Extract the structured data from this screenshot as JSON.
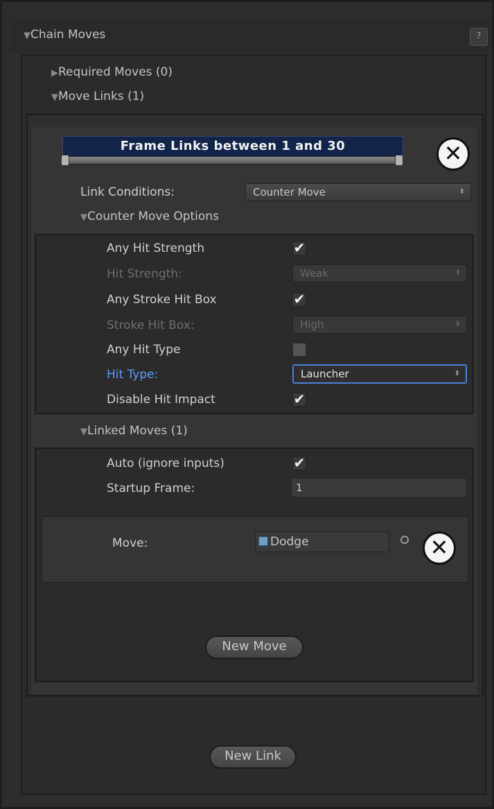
{
  "panel": {
    "title": "Chain Moves",
    "help_label": "?"
  },
  "sections": {
    "required_moves": "Required Moves (0)",
    "move_links": "Move Links (1)"
  },
  "link": {
    "frame_bar_label": "Frame Links between 1 and 30",
    "link_conditions_label": "Link Conditions:",
    "link_conditions_value": "Counter Move",
    "counter_move_options_label": "Counter Move Options",
    "options": {
      "any_hit_strength_label": "Any Hit Strength",
      "any_hit_strength_checked": true,
      "hit_strength_label": "Hit Strength:",
      "hit_strength_value": "Weak",
      "any_stroke_hit_box_label": "Any Stroke Hit Box",
      "any_stroke_hit_box_checked": true,
      "stroke_hit_box_label": "Stroke Hit Box:",
      "stroke_hit_box_value": "High",
      "any_hit_type_label": "Any Hit Type",
      "any_hit_type_checked": false,
      "hit_type_label": "Hit Type:",
      "hit_type_value": "Launcher",
      "disable_hit_impact_label": "Disable Hit Impact",
      "disable_hit_impact_checked": true
    },
    "linked_moves_label": "Linked Moves (1)",
    "auto_label": "Auto (ignore inputs)",
    "auto_checked": true,
    "startup_frame_label": "Startup Frame:",
    "startup_frame_value": "1",
    "move_label": "Move:",
    "move_value": "Dodge",
    "new_move_label": "New Move"
  },
  "new_link_label": "New Link",
  "glyphs": {
    "check": "✔",
    "close": "✕",
    "down_triangle": "▼",
    "right_triangle": "▶",
    "arrows": "⬍"
  },
  "colors": {
    "frame_bar": "#12244a",
    "focus_blue": "#4a80d8",
    "label_blue": "#5a9cff"
  }
}
